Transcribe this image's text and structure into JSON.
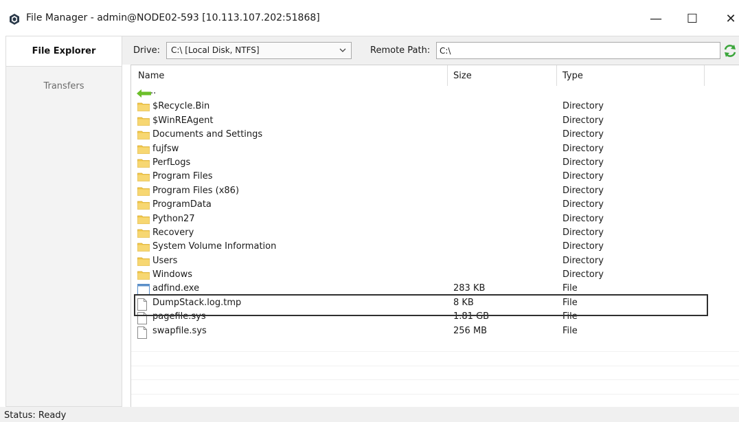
{
  "window": {
    "title": "File Manager - admin@NODE02-593 [10.113.107.202:51868]",
    "minimize_glyph": "—",
    "maximize_glyph": "☐",
    "close_glyph": "✕"
  },
  "nav": {
    "items": [
      {
        "label": "File Explorer",
        "active": true
      },
      {
        "label": "Transfers",
        "active": false
      }
    ]
  },
  "toolbar": {
    "drive_label": "Drive:",
    "drive_value": "C:\\ [Local Disk, NTFS]",
    "remote_path_label": "Remote Path:",
    "remote_path_value": "C:\\",
    "refresh_icon": "refresh-icon"
  },
  "columns": {
    "name": "Name",
    "size": "Size",
    "type": "Type"
  },
  "rows": [
    {
      "name": "..",
      "size": "",
      "type": "",
      "icon": "back-arrow-icon"
    },
    {
      "name": "$Recycle.Bin",
      "size": "",
      "type": "Directory",
      "icon": "folder-icon"
    },
    {
      "name": "$WinREAgent",
      "size": "",
      "type": "Directory",
      "icon": "folder-icon"
    },
    {
      "name": "Documents and Settings",
      "size": "",
      "type": "Directory",
      "icon": "folder-icon"
    },
    {
      "name": "fujfsw",
      "size": "",
      "type": "Directory",
      "icon": "folder-icon"
    },
    {
      "name": "PerfLogs",
      "size": "",
      "type": "Directory",
      "icon": "folder-icon"
    },
    {
      "name": "Program Files",
      "size": "",
      "type": "Directory",
      "icon": "folder-icon"
    },
    {
      "name": "Program Files (x86)",
      "size": "",
      "type": "Directory",
      "icon": "folder-icon"
    },
    {
      "name": "ProgramData",
      "size": "",
      "type": "Directory",
      "icon": "folder-icon"
    },
    {
      "name": "Python27",
      "size": "",
      "type": "Directory",
      "icon": "folder-icon"
    },
    {
      "name": "Recovery",
      "size": "",
      "type": "Directory",
      "icon": "folder-icon"
    },
    {
      "name": "System Volume Information",
      "size": "",
      "type": "Directory",
      "icon": "folder-icon"
    },
    {
      "name": "Users",
      "size": "",
      "type": "Directory",
      "icon": "folder-icon"
    },
    {
      "name": "Windows",
      "size": "",
      "type": "Directory",
      "icon": "folder-icon"
    },
    {
      "name": "adfind.exe",
      "size": "283 KB",
      "type": "File",
      "icon": "exe-file-icon"
    },
    {
      "name": "DumpStack.log.tmp",
      "size": "8 KB",
      "type": "File",
      "icon": "file-icon"
    },
    {
      "name": "pagefile.sys",
      "size": "1.81 GB",
      "type": "File",
      "icon": "file-icon"
    },
    {
      "name": "swapfile.sys",
      "size": "256 MB",
      "type": "File",
      "icon": "file-icon"
    }
  ],
  "status": {
    "text": "Status: Ready"
  },
  "colors": {
    "folder": "#f2c84b",
    "back_arrow": "#6cbf2a",
    "refresh": "#3aa53a"
  }
}
